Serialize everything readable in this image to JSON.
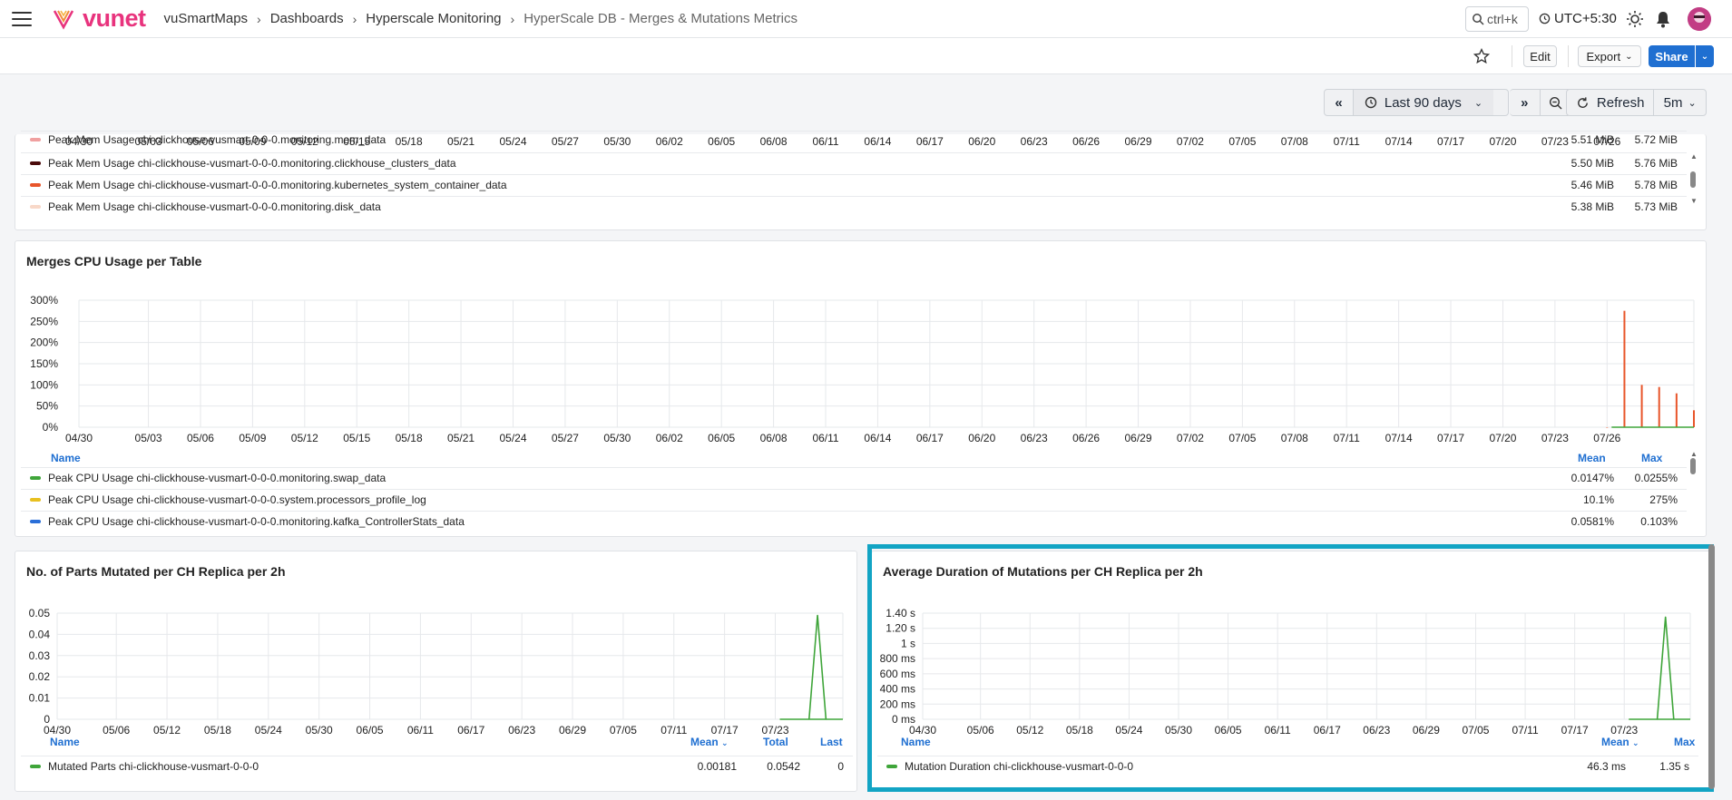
{
  "header": {
    "brand": "vunet",
    "breadcrumbs": [
      "vuSmartMaps",
      "Dashboards",
      "Hyperscale Monitoring",
      "HyperScale DB - Merges & Mutations Metrics"
    ],
    "search_placeholder": "ctrl+k",
    "timezone": "UTC+5:30"
  },
  "toolbar": {
    "edit": "Edit",
    "export": "Export",
    "share": "Share"
  },
  "timebar": {
    "range": "Last 90 days",
    "refresh": "Refresh",
    "interval": "5m"
  },
  "colors": {
    "accent": "#1f6fd1",
    "brand": "#e8337d",
    "highlight": "#12a4c4"
  },
  "x_dates_main": [
    "04/30",
    "05/03",
    "05/06",
    "05/09",
    "05/12",
    "05/15",
    "05/18",
    "05/21",
    "05/24",
    "05/27",
    "05/30",
    "06/02",
    "06/05",
    "06/08",
    "06/11",
    "06/14",
    "06/17",
    "06/20",
    "06/23",
    "06/26",
    "06/29",
    "07/02",
    "07/05",
    "07/08",
    "07/11",
    "07/14",
    "07/17",
    "07/20",
    "07/23",
    "07/26"
  ],
  "mem_panel": {
    "legend": [
      {
        "name": "Peak Mem Usage chi-clickhouse-vusmart-0-0-0.monitoring.mem_data",
        "color": "#f0a0a0",
        "mean": "5.51 MiB",
        "max": "5.72 MiB"
      },
      {
        "name": "Peak Mem Usage chi-clickhouse-vusmart-0-0-0.monitoring.clickhouse_clusters_data",
        "color": "#4a0a0a",
        "mean": "5.50 MiB",
        "max": "5.76 MiB"
      },
      {
        "name": "Peak Mem Usage chi-clickhouse-vusmart-0-0-0.monitoring.kubernetes_system_container_data",
        "color": "#e8552a",
        "mean": "5.46 MiB",
        "max": "5.78 MiB"
      },
      {
        "name": "Peak Mem Usage chi-clickhouse-vusmart-0-0-0.monitoring.disk_data",
        "color": "#f8d8c8",
        "mean": "5.38 MiB",
        "max": "5.73 MiB"
      }
    ]
  },
  "cpu_panel": {
    "title": "Merges CPU Usage per Table",
    "legend_headers": {
      "name": "Name",
      "mean": "Mean",
      "max": "Max"
    },
    "legend": [
      {
        "name": "Peak CPU Usage chi-clickhouse-vusmart-0-0-0.monitoring.swap_data",
        "color": "#3fa53a",
        "mean": "0.0147%",
        "max": "0.0255%"
      },
      {
        "name": "Peak CPU Usage chi-clickhouse-vusmart-0-0-0.system.processors_profile_log",
        "color": "#e8c020",
        "mean": "10.1%",
        "max": "275%"
      },
      {
        "name": "Peak CPU Usage chi-clickhouse-vusmart-0-0-0.monitoring.kafka_ControllerStats_data",
        "color": "#2a6fd8",
        "mean": "0.0581%",
        "max": "0.103%"
      }
    ]
  },
  "parts_panel": {
    "title": "No. of Parts Mutated per CH Replica per 2h",
    "legend_headers": {
      "name": "Name",
      "mean": "Mean",
      "total": "Total",
      "last": "Last"
    },
    "legend": [
      {
        "name": "Mutated Parts chi-clickhouse-vusmart-0-0-0",
        "color": "#3fa53a",
        "mean": "0.00181",
        "total": "0.0542",
        "last": "0"
      }
    ]
  },
  "duration_panel": {
    "title": "Average Duration of Mutations per CH Replica per 2h",
    "legend_headers": {
      "name": "Name",
      "mean": "Mean",
      "max": "Max"
    },
    "legend": [
      {
        "name": "Mutation Duration chi-clickhouse-vusmart-0-0-0",
        "color": "#3fa53a",
        "mean": "46.3 ms",
        "max": "1.35 s"
      }
    ]
  },
  "chart_data": [
    {
      "type": "bar",
      "title": "Merges CPU Usage per Table",
      "y_ticks": [
        "0%",
        "50%",
        "100%",
        "150%",
        "200%",
        "250%",
        "300%"
      ],
      "ylim": [
        0,
        300
      ],
      "x_ticks": [
        "04/30",
        "05/03",
        "05/06",
        "05/09",
        "05/12",
        "05/15",
        "05/18",
        "05/21",
        "05/24",
        "05/27",
        "05/30",
        "06/02",
        "06/05",
        "06/08",
        "06/11",
        "06/14",
        "06/17",
        "06/20",
        "06/23",
        "06/26",
        "06/29",
        "07/02",
        "07/05",
        "07/08",
        "07/11",
        "07/14",
        "07/17",
        "07/20",
        "07/23",
        "07/26"
      ],
      "series": [
        {
          "name": "Peak CPU Usage chi-clickhouse-vusmart-0-0-0.system.processors_profile_log",
          "color": "#e8552a",
          "points": [
            [
              "07/26",
              0
            ],
            [
              "07/27",
              275
            ],
            [
              "07/28",
              100
            ],
            [
              "07/29",
              95
            ],
            [
              "07/30",
              80
            ],
            [
              "07/31",
              40
            ]
          ]
        },
        {
          "name": "Peak CPU Usage chi-clickhouse-vusmart-0-0-0.monitoring.swap_data",
          "color": "#3fa53a",
          "points": [
            [
              "07/27",
              0.03
            ],
            [
              "07/29",
              0.02
            ]
          ]
        }
      ]
    },
    {
      "type": "line",
      "title": "No. of Parts Mutated per CH Replica per 2h",
      "y_ticks": [
        "0",
        "0.01",
        "0.02",
        "0.03",
        "0.04",
        "0.05"
      ],
      "ylim": [
        0,
        0.05
      ],
      "x_ticks": [
        "04/30",
        "05/06",
        "05/12",
        "05/18",
        "05/24",
        "05/30",
        "06/05",
        "06/11",
        "06/17",
        "06/23",
        "06/29",
        "07/05",
        "07/11",
        "07/17",
        "07/23"
      ],
      "series": [
        {
          "name": "Mutated Parts chi-clickhouse-vusmart-0-0-0",
          "color": "#3fa53a",
          "points": [
            [
              "07/27",
              0
            ],
            [
              "07/28",
              0.049
            ],
            [
              "07/29",
              0
            ]
          ]
        }
      ]
    },
    {
      "type": "line",
      "title": "Average Duration of Mutations per CH Replica per 2h",
      "y_ticks": [
        "0 ms",
        "200 ms",
        "400 ms",
        "600 ms",
        "800 ms",
        "1 s",
        "1.20 s",
        "1.40 s"
      ],
      "ylim": [
        0,
        1.4
      ],
      "x_ticks": [
        "04/30",
        "05/06",
        "05/12",
        "05/18",
        "05/24",
        "05/30",
        "06/05",
        "06/11",
        "06/17",
        "06/23",
        "06/29",
        "07/05",
        "07/11",
        "07/17",
        "07/23"
      ],
      "series": [
        {
          "name": "Mutation Duration chi-clickhouse-vusmart-0-0-0",
          "color": "#3fa53a",
          "points": [
            [
              "07/27",
              0
            ],
            [
              "07/28",
              1.35
            ],
            [
              "07/29",
              0
            ]
          ]
        }
      ]
    }
  ]
}
